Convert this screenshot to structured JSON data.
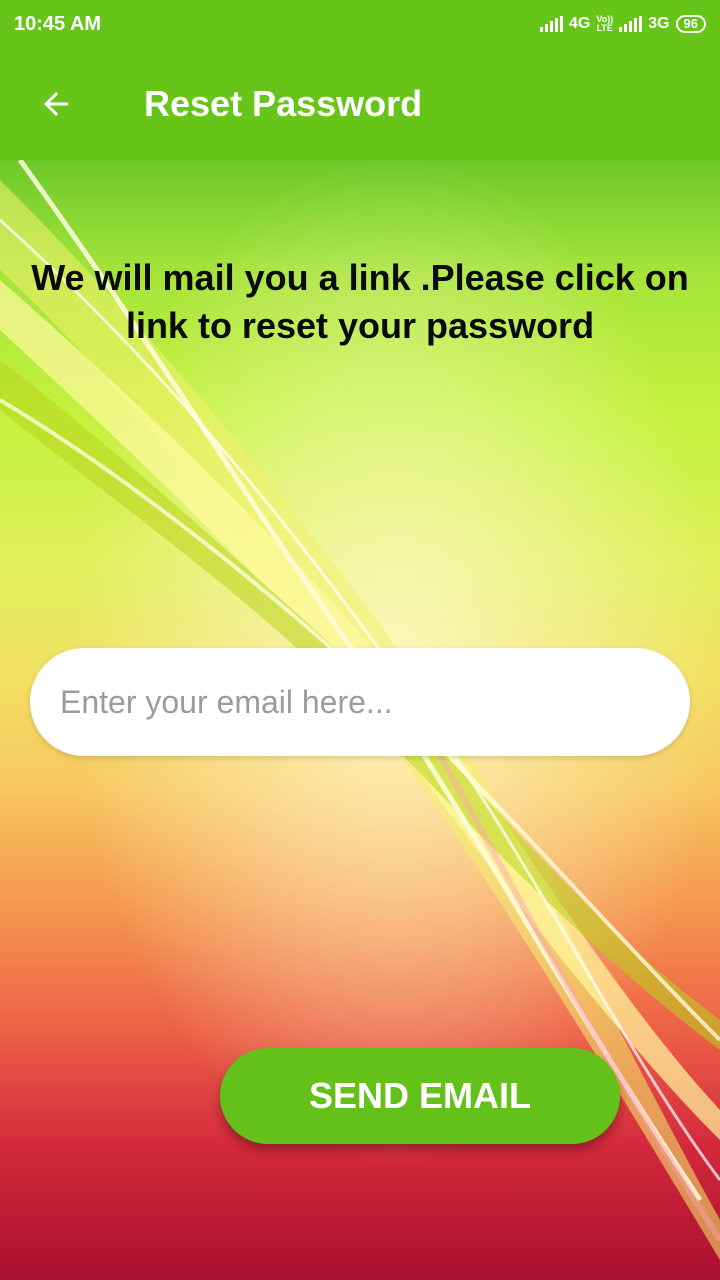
{
  "status_bar": {
    "time": "10:45 AM",
    "network_1": "4G",
    "volte": [
      "Vo))",
      "LTE"
    ],
    "network_2": "3G",
    "battery": "96"
  },
  "app_bar": {
    "back_icon": "arrow-back-icon",
    "title": "Reset Password"
  },
  "main": {
    "message": "We will mail you  a link .Please click on link to reset your password",
    "email_input": {
      "value": "",
      "placeholder": "Enter your email here..."
    },
    "send_button_label": "SEND EMAIL"
  },
  "colors": {
    "primary": "#67c419",
    "button": "#63c11a",
    "text": "#0a0a0a"
  }
}
